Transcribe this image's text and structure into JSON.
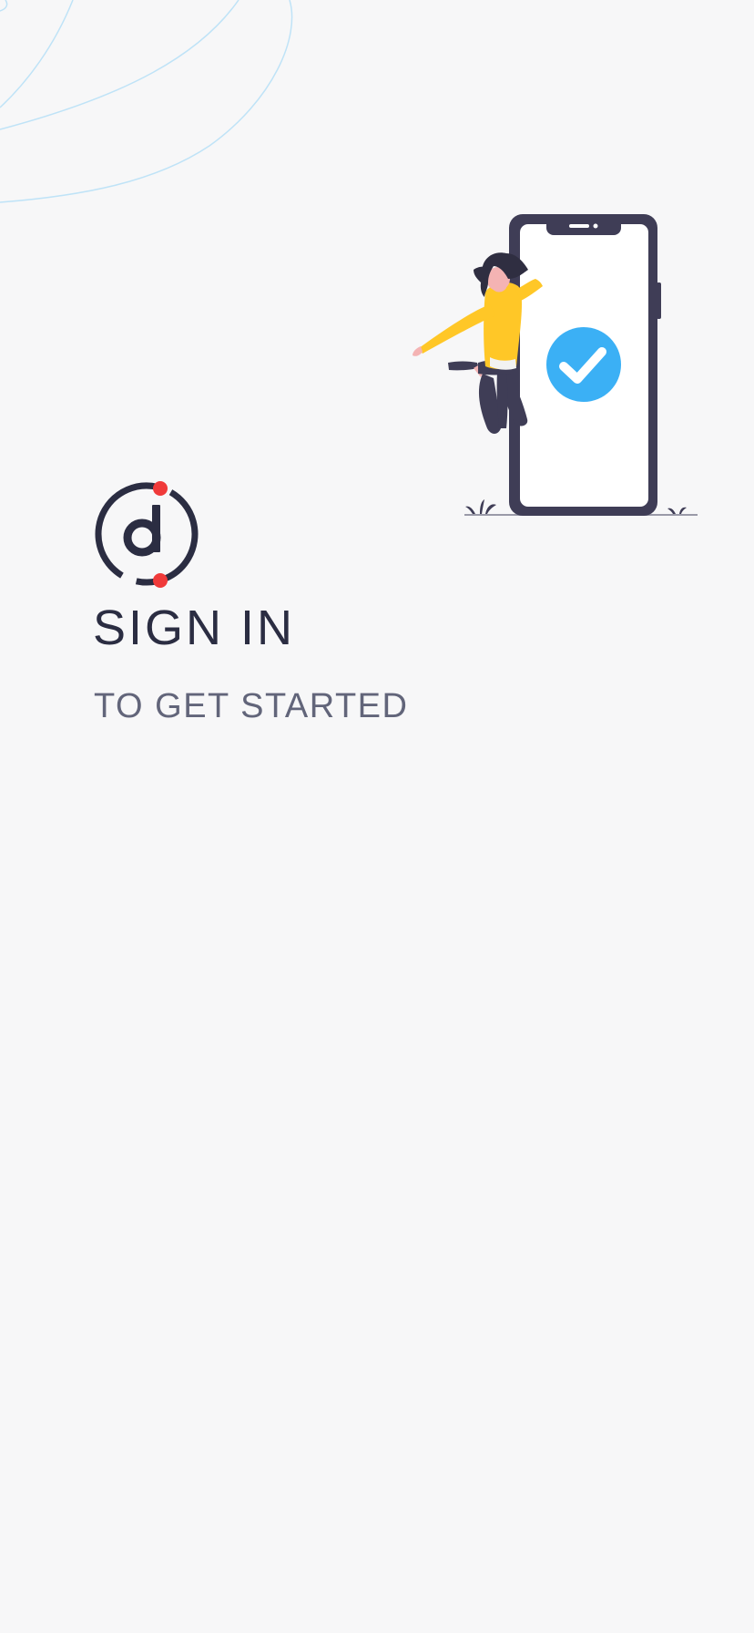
{
  "auth": {
    "title": "SIGN IN",
    "subtitle": "TO GET STARTED"
  },
  "colors": {
    "background": "#f7f7f8",
    "title": "#2b2d42",
    "subtitle": "#62657a",
    "logo_dark": "#2b2d42",
    "logo_accent": "#f03a3a",
    "check_badge": "#3bb0f5",
    "phone_frame": "#3f3d56",
    "shirt": "#ffc727",
    "curve_lines": "#bfe3f7"
  },
  "icons": {
    "logo": "brand-logo",
    "illustration": "woman-with-verified-phone-illustration",
    "badge": "check-circle-icon"
  }
}
